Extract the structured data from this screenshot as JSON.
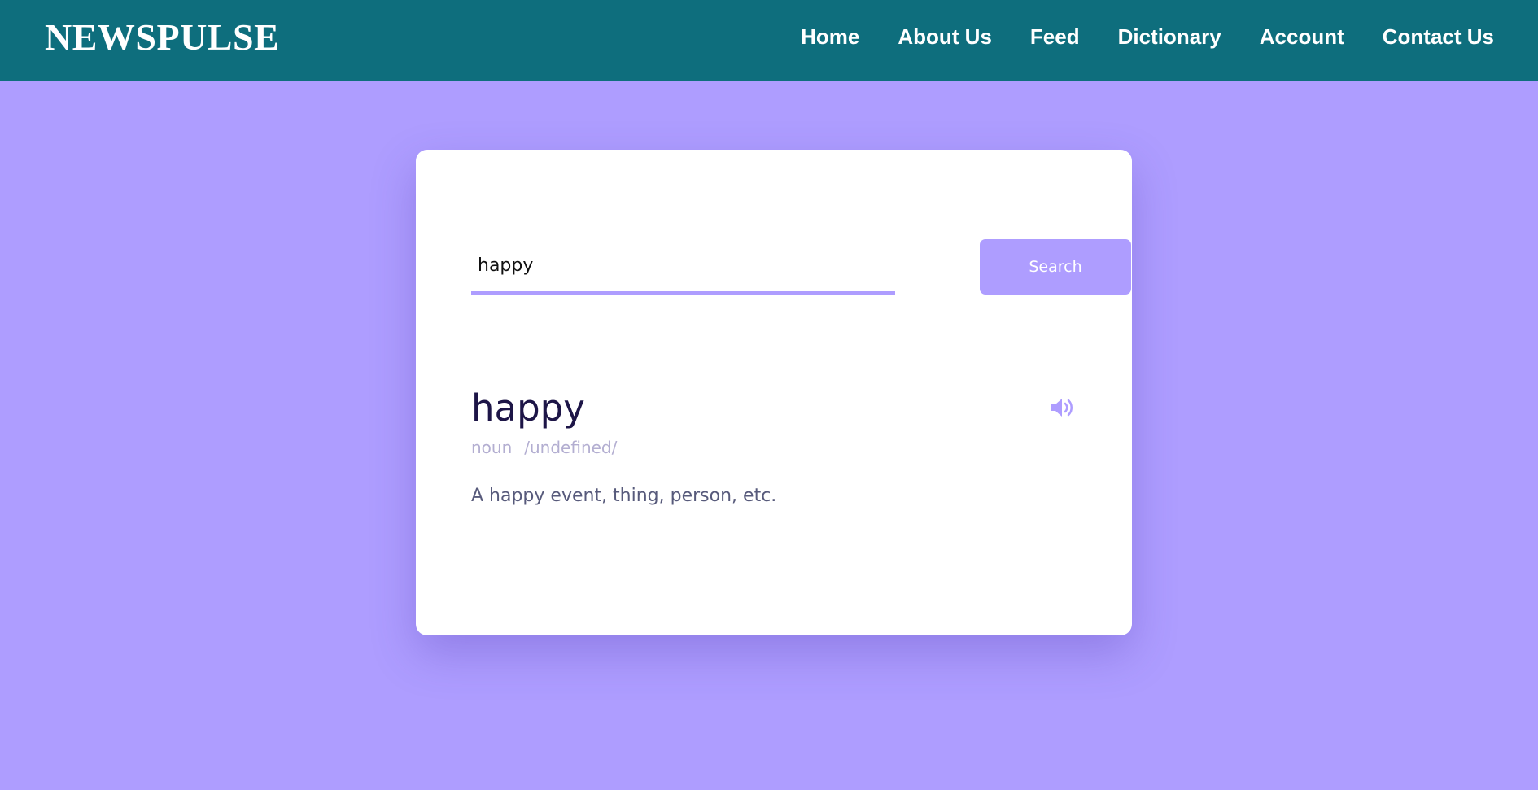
{
  "header": {
    "brand": "NEWSPULSE",
    "nav": [
      "Home",
      "About Us",
      "Feed",
      "Dictionary",
      "Account",
      "Contact Us"
    ]
  },
  "search": {
    "value": "happy",
    "button_label": "Search"
  },
  "result": {
    "word": "happy",
    "part_of_speech": "noun",
    "phonetic": "/undefined/",
    "definition": "A happy event, thing, person, etc."
  },
  "icons": {
    "speaker": "speaker-icon"
  },
  "colors": {
    "header_bg": "#0e6e7d",
    "page_bg": "#ae9dff",
    "accent": "#ae9dff",
    "word": "#1d1547",
    "muted": "#b3aed1",
    "definition": "#575a7b"
  }
}
